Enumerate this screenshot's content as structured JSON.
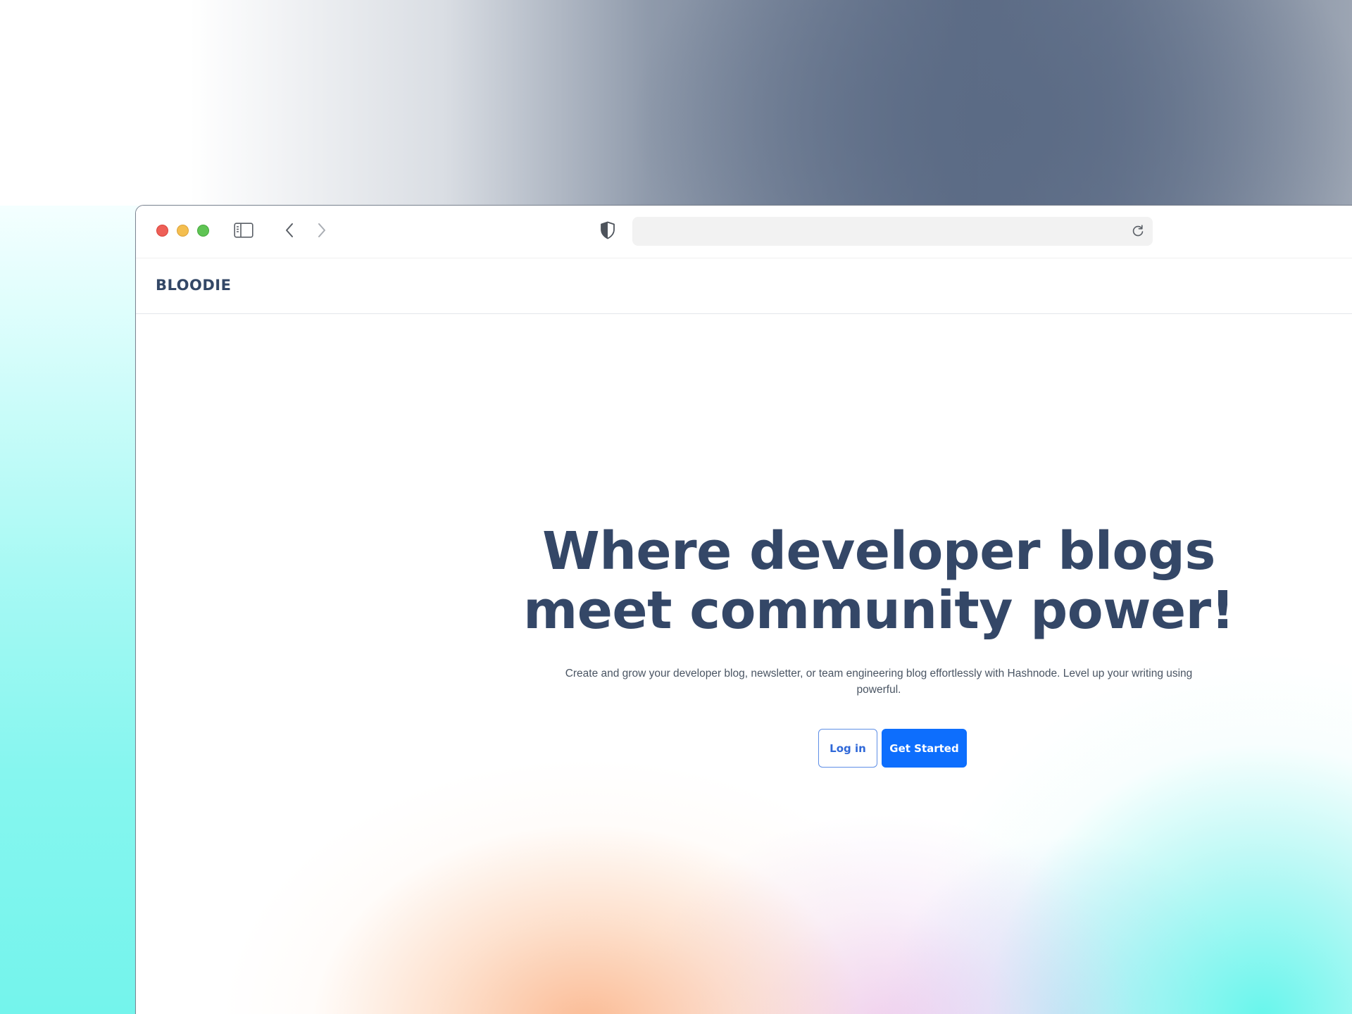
{
  "browser": {
    "address": {
      "value": "",
      "placeholder": ""
    },
    "icons": {
      "sidebar_toggle": "sidebar-icon",
      "back": "chevron-left-icon",
      "forward": "chevron-right-icon",
      "privacy": "shield-icon",
      "reload": "reload-icon"
    },
    "traffic_lights": {
      "close": "#ee5f57",
      "minimize": "#f4be4f",
      "zoom": "#5fc454"
    }
  },
  "site": {
    "brand": "BLOODIE",
    "hero": {
      "headline": "Where developer blogs meet community power!",
      "subtitle": "Create and grow your developer blog, newsletter, or team engineering blog effortlessly with Hashnode. Level up your writing using powerful.",
      "login_label": "Log in",
      "get_started_label": "Get Started"
    }
  },
  "colors": {
    "heading": "#344767",
    "primary_button": "#0d6efd",
    "outline_button_text": "#2f68d8"
  }
}
